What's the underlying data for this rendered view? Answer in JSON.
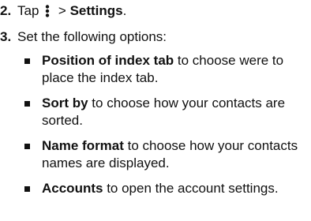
{
  "step2": {
    "number": "2.",
    "prefix": "Tap",
    "icon": "more-options-icon",
    "separator": ">",
    "target": "Settings",
    "end": "."
  },
  "step3": {
    "number": "3.",
    "text": "Set the following options:"
  },
  "options": [
    {
      "term": "Position of index tab",
      "desc": "to choose were to place the index tab."
    },
    {
      "term": "Sort by",
      "desc": "to choose how your contacts are sorted."
    },
    {
      "term": "Name format",
      "desc": "to choose how your contacts names are displayed."
    },
    {
      "term": "Accounts",
      "desc": "to open the account settings."
    }
  ]
}
